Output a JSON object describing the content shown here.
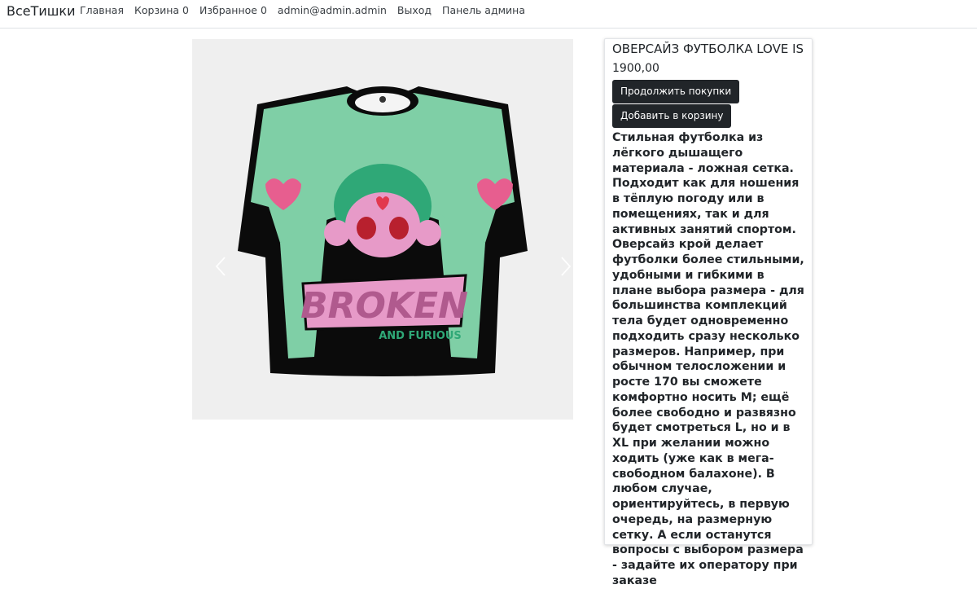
{
  "nav": {
    "brand": "ВсеТишки",
    "home": "Главная",
    "cart": "Корзина 0",
    "favorites": "Избранное 0",
    "user": "admin@admin.admin",
    "logout": "Выход",
    "admin_panel": "Панель админа"
  },
  "product": {
    "title": "ОВЕРСАЙЗ ФУТБОЛКА LOVE IS",
    "price": "1900,00",
    "continue_label": "Продолжить покупки",
    "add_to_cart_label": "Добавить в корзину",
    "description": "Стильная футболка из лёгкого дышащего материала - ложная сетка. Подходит как для ношения в тёплую погоду или в помещениях, так и для активных занятий спортом. Оверсайз крой делает футболки более стильными, удобными и гибкими в плане выбора размера - для большинства комплекций тела будет одновременно подходить сразу несколько размеров. Например, при обычном телосложении и росте 170 вы сможете комфортно носить М; ещё более свободно и развязно будет смотреться L, но и в XL при желании можно ходить (уже как в мега-свободном балахоне). В любом случае, ориентируйтесь, в первую очередь, на размерную сетку. А если останутся вопросы с выбором размера - задайте их оператору при заказе",
    "print_text_main": "BROKEN",
    "print_text_sub": "AND FURIOUS"
  },
  "carousel": {
    "prev_icon": "chevron-left-icon",
    "next_icon": "chevron-right-icon"
  },
  "colors": {
    "shirt_green": "#7fcfa6",
    "shirt_black": "#0b0b0b",
    "print_pink": "#e79ac8",
    "button_dark": "#212529"
  }
}
